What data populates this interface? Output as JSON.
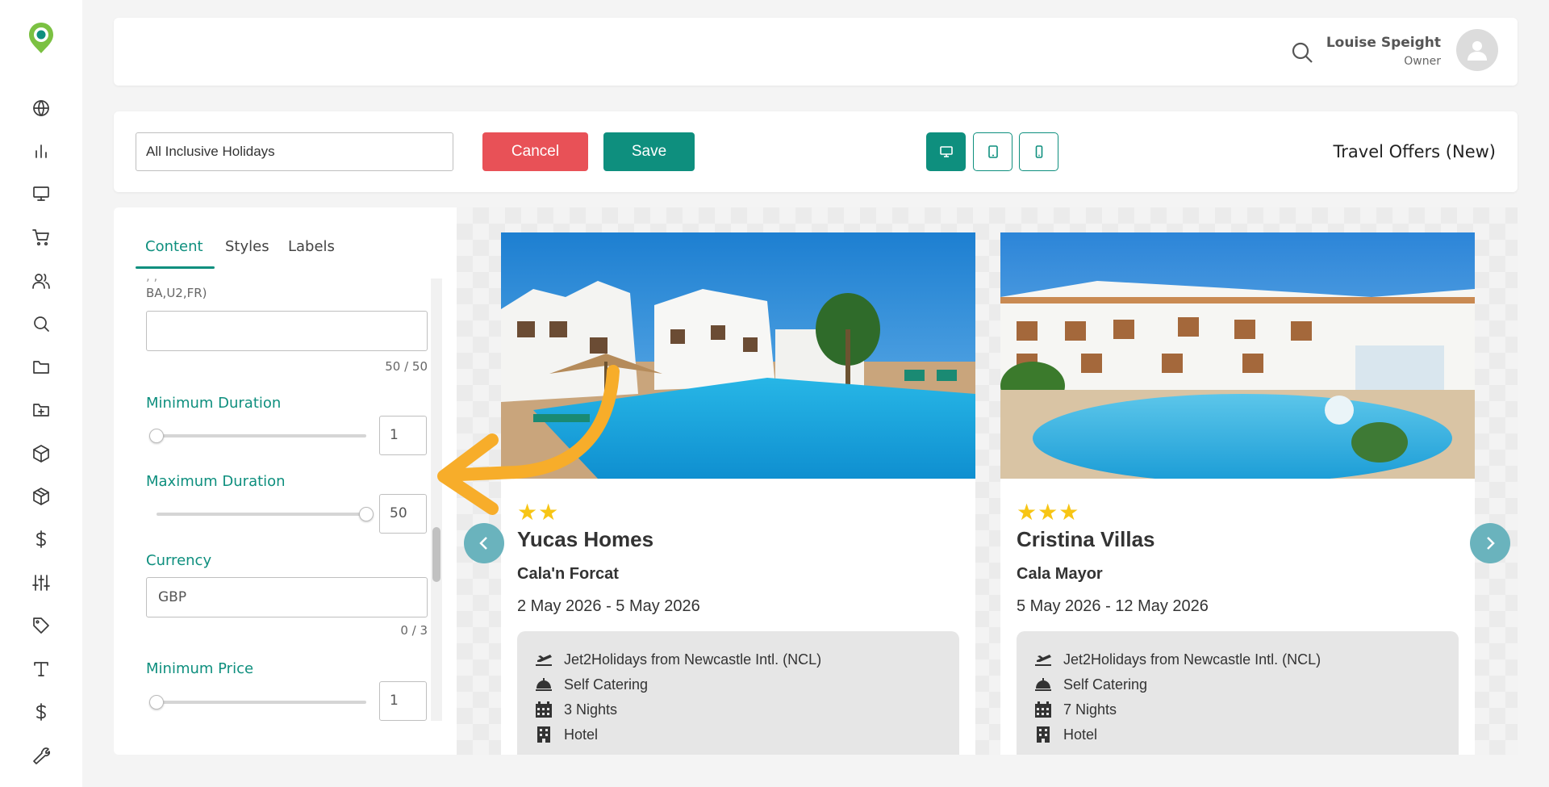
{
  "header": {
    "user_name": "Louise Speight",
    "user_role": "Owner"
  },
  "nav": {
    "items": [
      "globe-icon",
      "bar-chart-icon",
      "monitor-icon",
      "cart-icon",
      "users-icon",
      "search-icon",
      "folder-icon",
      "folder-plus-icon",
      "box-icon",
      "package-icon",
      "dollar-icon",
      "sliders-icon",
      "tag-icon",
      "type-icon",
      "dollar-icon",
      "wrench-icon"
    ]
  },
  "toolbar": {
    "name_value": "All Inclusive Holidays",
    "cancel_label": "Cancel",
    "save_label": "Save",
    "title": "Travel Offers (New)",
    "active_device": "desktop"
  },
  "editor": {
    "tabs": [
      {
        "label": "Content"
      },
      {
        "label": "Styles"
      },
      {
        "label": "Labels"
      }
    ],
    "airline_caption": "BA,U2,FR)",
    "airline_value": "",
    "airline_counter": "50 / 50",
    "min_duration": {
      "label": "Minimum Duration",
      "value": "1",
      "slider_fraction": 0.0
    },
    "max_duration": {
      "label": "Maximum Duration",
      "value": "50",
      "slider_fraction": 1.0
    },
    "currency": {
      "label": "Currency",
      "value": "GBP",
      "counter": "0 / 3"
    },
    "min_price": {
      "label": "Minimum Price",
      "value": "1",
      "slider_fraction": 0.0
    }
  },
  "preview": {
    "cards": [
      {
        "stars": 2,
        "title": "Yucas Homes",
        "location": "Cala'n Forcat",
        "dates": "2 May 2026 - 5 May 2026",
        "flight": "Jet2Holidays from Newcastle Intl. (NCL)",
        "board": "Self Catering",
        "nights": "3 Nights",
        "type": "Hotel"
      },
      {
        "stars": 3,
        "title": "Cristina Villas",
        "location": "Cala Mayor",
        "dates": "5 May 2026 - 12 May 2026",
        "flight": "Jet2Holidays from Newcastle Intl. (NCL)",
        "board": "Self Catering",
        "nights": "7 Nights",
        "type": "Hotel"
      }
    ]
  },
  "colors": {
    "brand": "#0e8f7e",
    "cancel": "#e85157",
    "star": "#f7c515",
    "carousel": "#6ab3bd",
    "annotation_arrow": "#f7ad2a"
  }
}
